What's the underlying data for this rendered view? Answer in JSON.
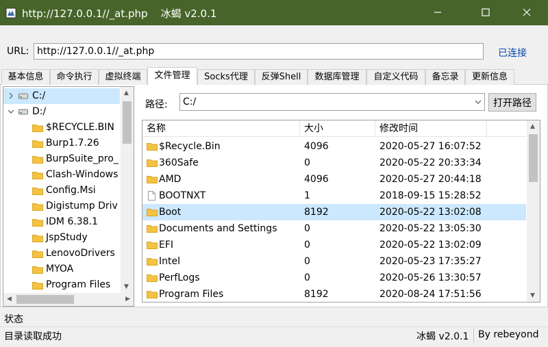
{
  "window": {
    "title": "http://127.0.0.1//_at.php    冰蝎 v2.0.1",
    "title_bar_color": "#47642a"
  },
  "url_bar": {
    "label": "URL:",
    "value": "http://127.0.0.1//_at.php",
    "status": "已连接",
    "status_color": "#0645ad"
  },
  "tabs": [
    {
      "label": "基本信息",
      "active": false
    },
    {
      "label": "命令执行",
      "active": false
    },
    {
      "label": "虚拟终端",
      "active": false
    },
    {
      "label": "文件管理",
      "active": true
    },
    {
      "label": "Socks代理",
      "active": false
    },
    {
      "label": "反弹Shell",
      "active": false
    },
    {
      "label": "数据库管理",
      "active": false
    },
    {
      "label": "自定义代码",
      "active": false
    },
    {
      "label": "备忘录",
      "active": false
    },
    {
      "label": "更新信息",
      "active": false
    }
  ],
  "tree": {
    "drives": [
      {
        "label": "C:/",
        "expanded": false,
        "selected": true
      },
      {
        "label": "D:/",
        "expanded": true,
        "selected": false
      }
    ],
    "d_children": [
      "$RECYCLE.BIN",
      "Burp1.7.26",
      "BurpSuite_pro_",
      "Clash-Windows",
      "Config.Msi",
      "Digistump Driv",
      "IDM 6.38.1",
      "JspStudy",
      "LenovoDrivers",
      "MYOA",
      "Program Files"
    ]
  },
  "path": {
    "label": "路径:",
    "value": "C:/",
    "open_button": "打开路径"
  },
  "file_list": {
    "columns": [
      "名称",
      "大小",
      "修改时间"
    ],
    "rows": [
      {
        "name": "$Recycle.Bin",
        "size": "4096",
        "modified": "2020-05-27 16:07:52",
        "type": "folder",
        "selected": false
      },
      {
        "name": "360Safe",
        "size": "0",
        "modified": "2020-05-22 20:33:34",
        "type": "folder",
        "selected": false
      },
      {
        "name": "AMD",
        "size": "4096",
        "modified": "2020-05-27 20:44:18",
        "type": "folder",
        "selected": false
      },
      {
        "name": "BOOTNXT",
        "size": "1",
        "modified": "2018-09-15 15:28:52",
        "type": "file",
        "selected": false
      },
      {
        "name": "Boot",
        "size": "8192",
        "modified": "2020-05-22 13:02:08",
        "type": "folder",
        "selected": true
      },
      {
        "name": "Documents and Settings",
        "size": "0",
        "modified": "2020-05-22 13:05:30",
        "type": "folder",
        "selected": false
      },
      {
        "name": "EFI",
        "size": "0",
        "modified": "2020-05-22 13:02:09",
        "type": "folder",
        "selected": false
      },
      {
        "name": "Intel",
        "size": "0",
        "modified": "2020-05-23 17:35:27",
        "type": "folder",
        "selected": false
      },
      {
        "name": "PerfLogs",
        "size": "0",
        "modified": "2020-05-26 13:30:57",
        "type": "folder",
        "selected": false
      },
      {
        "name": "Program Files",
        "size": "8192",
        "modified": "2020-08-24 17:51:56",
        "type": "folder",
        "selected": false
      }
    ]
  },
  "status": {
    "title": "状态",
    "message": "目录读取成功",
    "version": "冰蝎 v2.0.1",
    "author": "By rebeyond"
  },
  "colors": {
    "folder": "#f4c343",
    "selection": "#cce8ff"
  }
}
